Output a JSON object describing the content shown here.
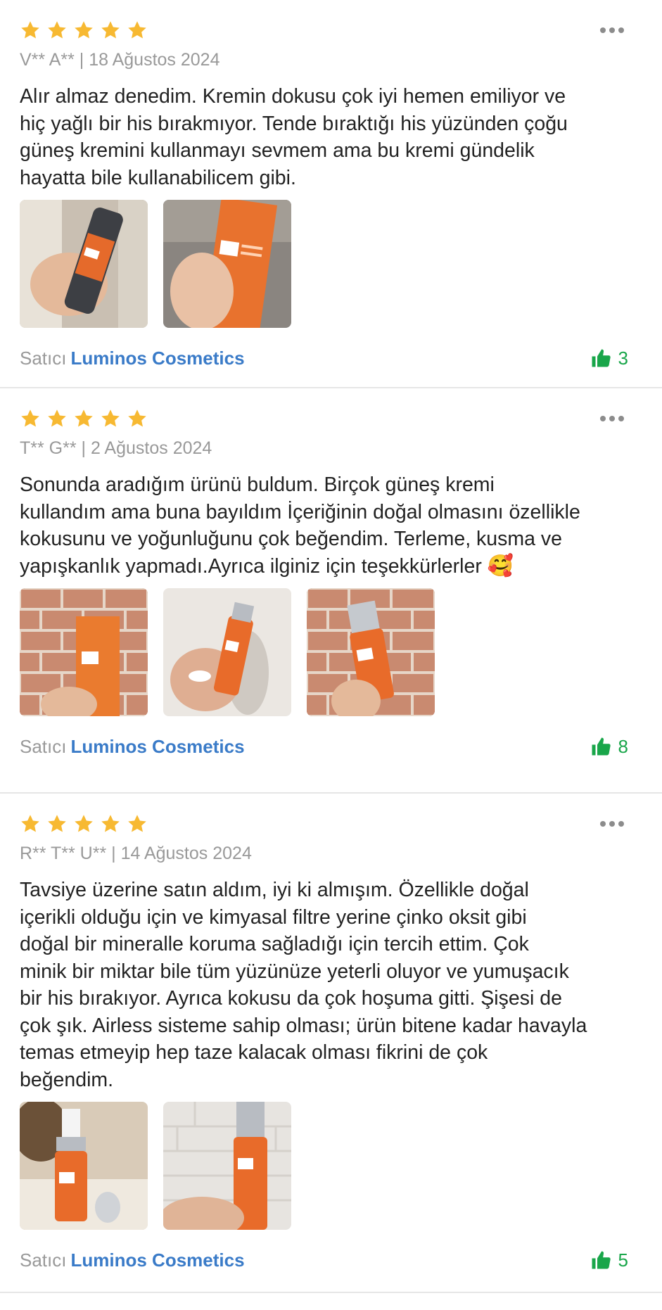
{
  "colors": {
    "star": "#f7b932",
    "seller": "#3a7bc8",
    "like": "#19a64a",
    "meta": "#999999"
  },
  "reviews": [
    {
      "rating": 5,
      "author_date": "V** A** | 18 Ağustos 2024",
      "text": "Alır almaz denedim. Kremin dokusu çok iyi hemen emiliyor ve\nhiç yağlı bir his bırakmıyor. Tende bıraktığı his yüzünden çoğu\ngüneş kremini kullanmayı sevmem ama bu kremi gündelik\nhayatta bile kullanabilicem gibi.",
      "photo_count": 2,
      "seller_label": "Satıcı",
      "seller_name": "Luminos Cosmetics",
      "likes": "3"
    },
    {
      "rating": 5,
      "author_date": "T** G** | 2 Ağustos 2024",
      "text": "Sonunda aradığım ürünü buldum. Birçok güneş kremi\nkullandım ama buna bayıldım İçeriğinin doğal olmasını özellikle\nkokusunu ve yoğunluğunu çok beğendim. Terleme, kusma ve\nyapışkanlık yapmadı.Ayrıca ilginiz için teşekkürlerler",
      "emoji": "🥰",
      "photo_count": 3,
      "seller_label": "Satıcı",
      "seller_name": "Luminos Cosmetics",
      "likes": "8"
    },
    {
      "rating": 5,
      "author_date": "R** T** U** | 14 Ağustos 2024",
      "text": "Tavsiye üzerine satın aldım, iyi ki almışım. Özellikle doğal\niçerikli olduğu için ve  kimyasal filtre yerine çinko oksit gibi\ndoğal bir mineralle koruma sağladığı için tercih ettim.  Çok\nminik bir miktar bile tüm yüzünüze yeterli oluyor ve yumuşacık\nbir his bırakıyor. Ayrıca kokusu da çok hoşuma gitti. Şişesi de\nçok şık. Airless sisteme sahip olması; ürün bitene kadar havayla\ntemas etmeyip hep taze kalacak olması fikrini de çok\nbeğendim.",
      "photo_count": 2,
      "seller_label": "Satıcı",
      "seller_name": "Luminos Cosmetics",
      "likes": "5"
    }
  ],
  "icons": {
    "star": "star-icon",
    "more": "more-options-icon",
    "like": "thumbs-up-icon"
  }
}
